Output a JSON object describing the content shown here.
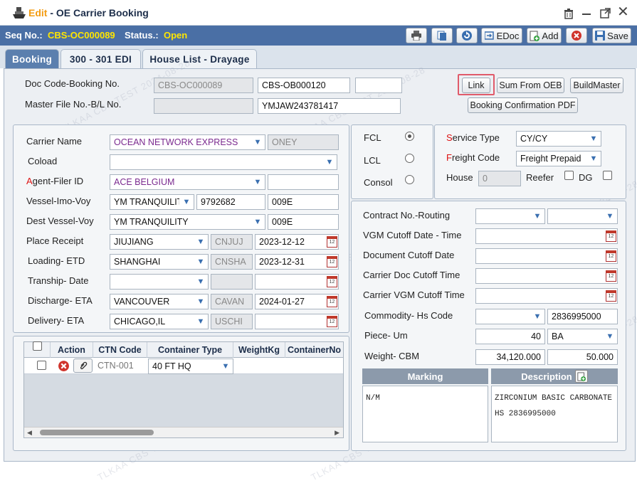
{
  "window": {
    "mode": "Edit",
    "title": "OE Carrier Booking"
  },
  "seqbar": {
    "seq_label": "Seq No.:",
    "seq_value": "CBS-OC000089",
    "status_label": "Status.:",
    "status_value": "Open"
  },
  "toolbar": {
    "edoc": "EDoc",
    "add": "Add",
    "save": "Save"
  },
  "tabs": [
    "Booking",
    "300 - 301 EDI",
    "House List - Drayage"
  ],
  "header": {
    "doc_code_label": "Doc Code-Booking No.",
    "doc_code": "CBS-OC000089",
    "booking_no": "CBS-OB000120",
    "booking_extra": "",
    "master_label": "Master File No.-B/L No.",
    "master_file": "",
    "bl_no": "YMJAW243781417",
    "link_button": "Link",
    "sum_button": "Sum From OEB",
    "buildmaster_button": "BuildMaster",
    "bcpdf_button": "Booking Confirmation PDF"
  },
  "left": {
    "carrier_label": "Carrier Name",
    "carrier_name": "OCEAN NETWORK EXPRESS",
    "carrier_code": "ONEY",
    "coload_label": "Coload",
    "coload": "",
    "agent_label_first": "A",
    "agent_label_rest": "gent-Filer ID",
    "agent": "ACE BELGIUM",
    "agent_extra": "",
    "vessel_label": "Vessel-Imo-Voy",
    "vessel": "YM TRANQUILIT",
    "imo": "9792682",
    "voy": "009E",
    "dest_vessel_label": "Dest Vessel-Voy",
    "dest_vessel": "YM TRANQUILITY",
    "dest_voy": "009E",
    "place_receipt_label": "Place Receipt",
    "place_receipt": "JIUJIANG",
    "place_receipt_code": "CNJUJ",
    "place_receipt_date": "2023-12-12",
    "loading_label": "Loading- ETD",
    "loading": "SHANGHAI",
    "loading_code": "CNSHA",
    "loading_date": "2023-12-31",
    "tranship_label": "Tranship- Date",
    "tranship": "",
    "tranship_code": "",
    "tranship_date": "",
    "discharge_label": "Discharge- ETA",
    "discharge": "VANCOUVER",
    "discharge_code": "CAVAN",
    "discharge_date": "2024-01-27",
    "delivery_label": "Delivery- ETA",
    "delivery": "CHICAGO,IL",
    "delivery_code": "USCHI",
    "delivery_date": ""
  },
  "cargo_type": {
    "fcl": "FCL",
    "lcl": "LCL",
    "consol": "Consol",
    "selected": "FCL"
  },
  "service": {
    "service_label_first": "S",
    "service_label_rest": "ervice Type",
    "service_type": "CY/CY",
    "freight_label_first": "F",
    "freight_label_rest": "reight Code",
    "freight_code": "Freight Prepaid",
    "house_label": "House",
    "house_value": "0",
    "reefer_label": "Reefer",
    "dg_label": "DG"
  },
  "right": {
    "contract_label": "Contract No.-Routing",
    "contract": "",
    "routing": "",
    "vgm_label": "VGM Cutoff Date - Time",
    "vgm": "",
    "doc_cutoff_label": "Document Cutoff Date",
    "doc_cutoff": "",
    "carrier_doc_label": "Carrier Doc Cutoff Time",
    "carrier_doc": "",
    "carrier_vgm_label": "Carrier VGM Cutoff Time",
    "carrier_vgm": "",
    "commodity_label": "Commodity- Hs Code",
    "commodity": "",
    "hs_code": "2836995000",
    "piece_label": "Piece- Um",
    "piece": "40",
    "um": "BA",
    "weight_label": "Weight- CBM",
    "weight": "34,120.000",
    "cbm": "50.000"
  },
  "container_table": {
    "headers": [
      "Action",
      "CTN Code",
      "Container Type",
      "WeightKg",
      "ContainerNo"
    ],
    "rows": [
      {
        "ctn_code": "CTN-001",
        "container_type": "40 FT HQ",
        "weight": "",
        "container_no": ""
      }
    ]
  },
  "marking": {
    "marking_label": "Marking",
    "description_label": "Description",
    "marking_text": "N/M",
    "description_line1": "ZIRCONIUM BASIC CARBONATE",
    "description_line2": "HS 2836995000"
  },
  "watermark": "TLKAA CBS TEST 2024-08-28",
  "colors": {
    "accent_bar": "#4a6fa5",
    "seq_value": "#ffe600",
    "edit_mode": "#f39c12",
    "required_letter": "#dd1111",
    "link_highlight": "#e05a6a",
    "purple_text": "#7b2a8f"
  }
}
